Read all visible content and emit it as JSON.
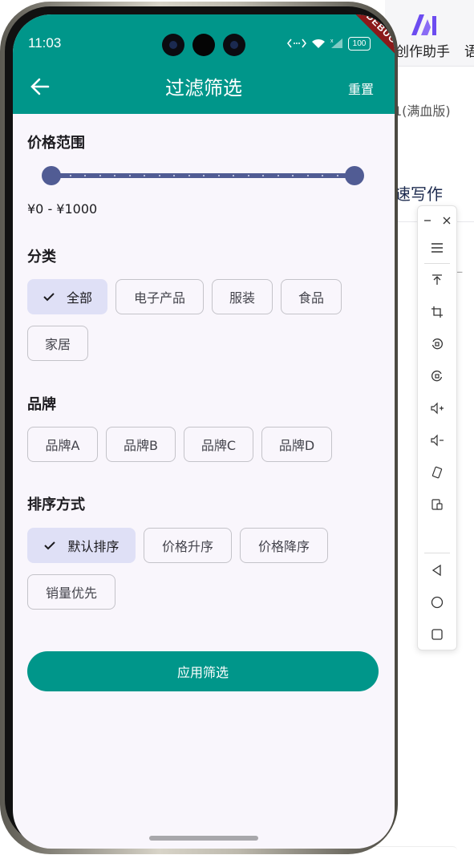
{
  "background_app": {
    "tab1": "创作助手",
    "tab2": "语",
    "model_label": "1(满血版)",
    "write_label": "速写作",
    "fragment": "一",
    "brand_color": "#6c4cf0"
  },
  "status_bar": {
    "time": "11:03",
    "battery": "100",
    "debug_banner": "DEBUG"
  },
  "appbar": {
    "title": "过滤筛选",
    "reset_label": "重置",
    "color": "#00968a"
  },
  "price_range": {
    "title": "价格范围",
    "min": 0,
    "max": 1000,
    "lower_value": 0,
    "upper_value": 1000,
    "label": "¥0 - ¥1000"
  },
  "category": {
    "title": "分类",
    "chips": [
      {
        "label": "全部",
        "selected": true
      },
      {
        "label": "电子产品",
        "selected": false
      },
      {
        "label": "服装",
        "selected": false
      },
      {
        "label": "食品",
        "selected": false
      },
      {
        "label": "家居",
        "selected": false
      }
    ]
  },
  "brand": {
    "title": "品牌",
    "chips": [
      {
        "label": "品牌A",
        "selected": false
      },
      {
        "label": "品牌B",
        "selected": false
      },
      {
        "label": "品牌C",
        "selected": false
      },
      {
        "label": "品牌D",
        "selected": false
      }
    ]
  },
  "sort": {
    "title": "排序方式",
    "chips": [
      {
        "label": "默认排序",
        "selected": true
      },
      {
        "label": "价格升序",
        "selected": false
      },
      {
        "label": "价格降序",
        "selected": false
      },
      {
        "label": "销量优先",
        "selected": false
      }
    ]
  },
  "apply_label": "应用筛选",
  "tool_panel": {
    "icons": [
      "minimize-icon",
      "close-icon",
      "menu-icon",
      "pin-top-icon",
      "crop-icon",
      "rotate-left-icon",
      "rotate-right-icon",
      "volume-up-icon",
      "volume-down-icon",
      "shake-icon",
      "screenshot-icon",
      "nav-back-icon",
      "nav-home-icon",
      "nav-recent-icon"
    ]
  }
}
